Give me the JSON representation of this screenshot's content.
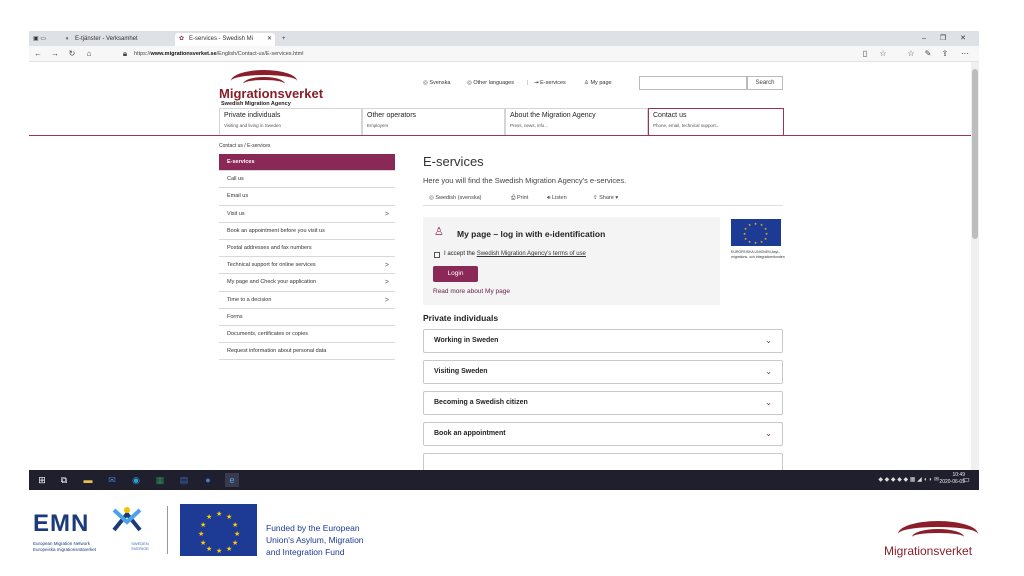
{
  "browser": {
    "tabs": [
      {
        "label": "E-tjänster - Verksamhet"
      },
      {
        "label": "E-services - Swedish Mi"
      }
    ],
    "new_tab": "+",
    "url_prefix": "https://",
    "url_domain": "www.migrationsverket.se",
    "url_path": "/English/Contact-us/E-services.html",
    "window_controls": {
      "minimize": "–",
      "maximize": "❐",
      "close": "✕"
    }
  },
  "header": {
    "logo_name": "Migrationsverket",
    "logo_sub": "Swedish Migration Agency",
    "links": {
      "svenska": "Svenska",
      "other_languages": "Other languages",
      "eservices": "E-services",
      "mypage": "My page"
    },
    "search_button": "Search"
  },
  "mainnav": [
    {
      "title": "Private individuals",
      "sub": "Visiting and living in Sweden"
    },
    {
      "title": "Other operators",
      "sub": "Employers"
    },
    {
      "title": "About the Migration Agency",
      "sub": "Press, news, info..."
    },
    {
      "title": "Contact us",
      "sub": "Phone, email, technical support..."
    }
  ],
  "breadcrumb": "Contact us / E-services",
  "sidebar": [
    {
      "label": "E-services",
      "chev": ""
    },
    {
      "label": "Call us",
      "chev": ""
    },
    {
      "label": "Email us",
      "chev": ""
    },
    {
      "label": "Visit us",
      "chev": ">"
    },
    {
      "label": "Book an appointment before you visit us",
      "chev": ""
    },
    {
      "label": "Postal addresses and fax numbers",
      "chev": ""
    },
    {
      "label": "Technical support for online services",
      "chev": ">"
    },
    {
      "label": "My page and Check your application",
      "chev": ">"
    },
    {
      "label": "Time to a decision",
      "chev": ">"
    },
    {
      "label": "Forms",
      "chev": ""
    },
    {
      "label": "Documents, certificates or copies",
      "chev": ""
    },
    {
      "label": "Request information about personal data",
      "chev": ""
    }
  ],
  "main": {
    "title": "E-services",
    "intro": "Here you will find the Swedish Migration Agency's e-services.",
    "tools": {
      "language": "Swedish (svenska)",
      "print": "Print",
      "listen": "Listen",
      "share": "Share"
    },
    "mypage": {
      "title": "My page – log in with e-identification",
      "accept_prefix": "I accept the",
      "accept_link": "Swedish Migration Agency's terms of use",
      "login": "Login",
      "read_more": "Read more about My page"
    },
    "eu_text": "EUROPEISKA UNIONEN Asyl-, migrations- och integrationsfonden",
    "private_heading": "Private individuals",
    "accordions": [
      {
        "label": "Working in Sweden"
      },
      {
        "label": "Visiting Sweden"
      },
      {
        "label": "Becoming a Swedish citizen"
      },
      {
        "label": "Book an appointment"
      }
    ]
  },
  "taskbar": {
    "time": "10:49",
    "date": "2020-06-09"
  },
  "footer": {
    "emn": "EMN",
    "emn_line1": "European Migration Network",
    "emn_line2": "Europeiska migrationsnätverket",
    "emn_sweden": "SWEDEN SVERIGE",
    "funded1": "Funded by the European",
    "funded2": "Union's Asylum, Migration",
    "funded3": "and Integration Fund",
    "logo": "Migrationsverket"
  }
}
